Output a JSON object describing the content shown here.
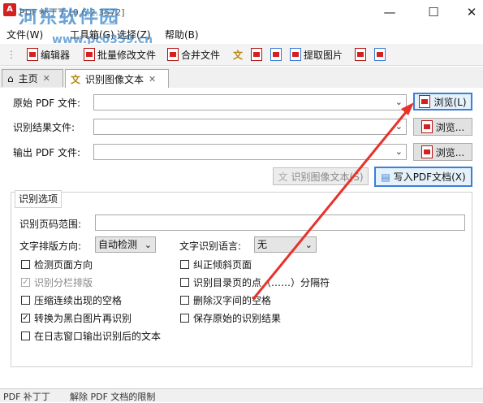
{
  "window": {
    "title": "PDF 补丁丁 [0.6.2.3572]",
    "watermark": "河东软件园",
    "watermark_url": "www.pc0359.cn",
    "controls": {
      "minimize": "—",
      "maximize": "☐",
      "close": "✕"
    }
  },
  "menu": {
    "items": [
      "文件(W)",
      "工具箱(G)",
      "选择(Z)",
      "帮助(B)"
    ]
  },
  "toolbar": {
    "editor": "编辑器",
    "batch_modify": "批量修改文件",
    "merge": "合并文件",
    "extract_images": "提取图片"
  },
  "tabs": [
    {
      "label": "主页",
      "close": "✕"
    },
    {
      "label": "识别图像文本",
      "close": "✕"
    }
  ],
  "form": {
    "source_pdf_label": "原始 PDF 文件:",
    "source_pdf_value": "",
    "result_file_label": "识别结果文件:",
    "result_file_value": "",
    "output_pdf_label": "输出 PDF 文件:",
    "output_pdf_value": "",
    "browse_focused": "浏览(L)",
    "browse_1": "浏览...",
    "browse_2": "浏览...",
    "ocr_button": "识别图像文本(S)",
    "write_pdf_button": "写入PDF文档(X)"
  },
  "options": {
    "group_title": "识别选项",
    "page_range_label": "识别页码范围:",
    "page_range_value": "",
    "layout_direction_label": "文字排版方向:",
    "layout_direction_value": "自动检测",
    "language_label": "文字识别语言:",
    "language_value": "无",
    "checkboxes": [
      {
        "label": "检测页面方向",
        "checked": false,
        "disabled": false
      },
      {
        "label": "识别分栏排版",
        "checked": true,
        "disabled": true
      },
      {
        "label": "压缩连续出现的空格",
        "checked": false,
        "disabled": false
      },
      {
        "label": "转换为黑白图片再识别",
        "checked": true,
        "disabled": false
      },
      {
        "label": "在日志窗口输出识别后的文本",
        "checked": false,
        "disabled": false
      },
      {
        "label": "纠正倾斜页面",
        "checked": false,
        "disabled": false
      },
      {
        "label": "识别目录页的点（……）分隔符",
        "checked": false,
        "disabled": false
      },
      {
        "label": "删除汉字间的空格",
        "checked": false,
        "disabled": false
      },
      {
        "label": "保存原始的识别结果",
        "checked": false,
        "disabled": false
      }
    ]
  },
  "statusbar": {
    "left": "PDF 补丁丁",
    "right": "解除 PDF 文档的限制"
  },
  "colors": {
    "accent": "#3c7fd6",
    "arrow": "#e8322a",
    "pdf_red": "#d62020"
  }
}
